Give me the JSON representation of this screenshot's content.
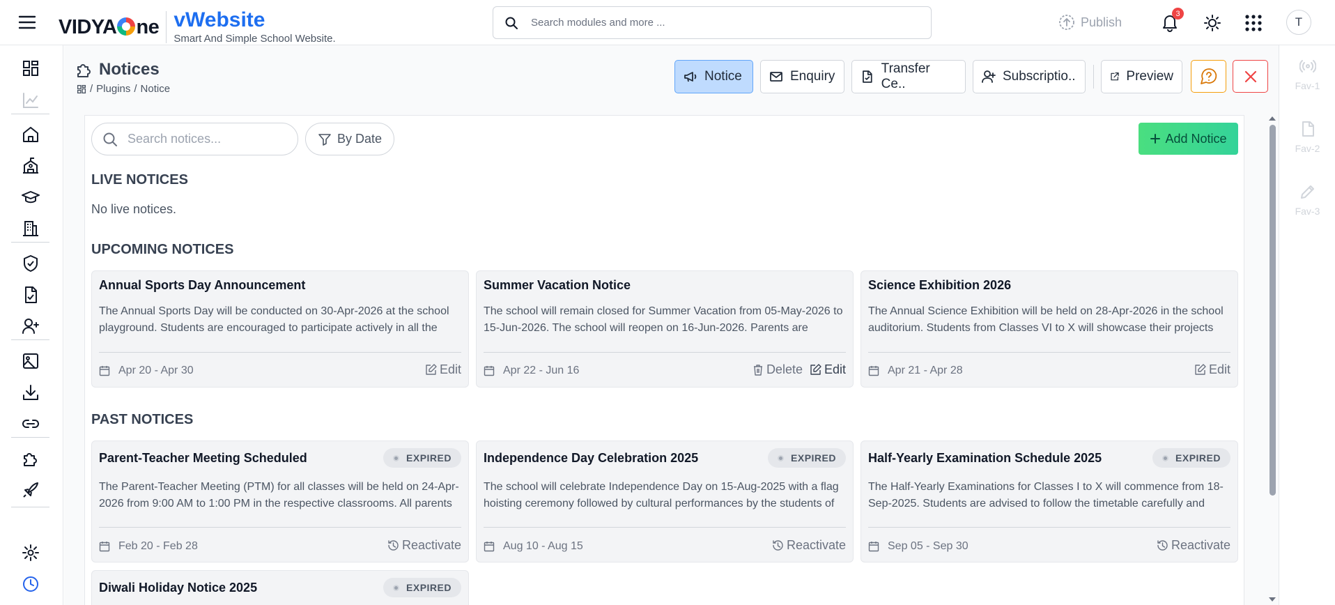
{
  "header": {
    "logo_text": "VIDYAOne",
    "product_name": "vWebsite",
    "tagline": "Smart And Simple School Website.",
    "search_placeholder": "Search modules and more ...",
    "publish_label": "Publish",
    "notification_count": "3",
    "avatar_initial": "T"
  },
  "page": {
    "title": "Notices",
    "breadcrumb": [
      "Plugins",
      "Notice"
    ]
  },
  "toolbar": {
    "tabs": [
      {
        "label": "Notice",
        "icon": "megaphone-icon",
        "active": true
      },
      {
        "label": "Enquiry",
        "icon": "mail-icon",
        "active": false
      },
      {
        "label": "Transfer Ce..",
        "icon": "file-check-icon",
        "active": false
      },
      {
        "label": "Subscriptio..",
        "icon": "user-plus-icon",
        "active": false
      }
    ],
    "preview_label": "Preview"
  },
  "favorites": [
    "Fav-1",
    "Fav-2",
    "Fav-3"
  ],
  "filters": {
    "search_placeholder": "Search notices...",
    "by_date_label": "By Date",
    "add_label": "Add Notice"
  },
  "live": {
    "heading": "LIVE NOTICES",
    "empty_text": "No live notices."
  },
  "upcoming": {
    "heading": "UPCOMING NOTICES",
    "cards": [
      {
        "title": "Annual Sports Day Announcement",
        "description": "The Annual Sports Day will be conducted on 30-Apr-2026 at the school playground. Students are encouraged to participate actively in all the events.",
        "dates": "Apr 20 - Apr 30",
        "delete": "",
        "edit": "Edit"
      },
      {
        "title": "Summer Vacation Notice",
        "description": "The school will remain closed for Summer Vacation from 05-May-2026 to 15-Jun-2026. The school will reopen on 16-Jun-2026. Parents are requested to take note.",
        "dates": "Apr 22 - Jun 16",
        "delete": "Delete",
        "edit": "Edit"
      },
      {
        "title": "Science Exhibition 2026",
        "description": "The Annual Science Exhibition will be held on 28-Apr-2026 in the school auditorium. Students from Classes VI to X will showcase their projects and models.",
        "dates": "Apr 21 - Apr 28",
        "delete": "",
        "edit": "Edit"
      }
    ]
  },
  "past": {
    "heading": "PAST NOTICES",
    "status_label": "EXPIRED",
    "cards": [
      {
        "title": "Parent-Teacher Meeting Scheduled",
        "description": "The Parent-Teacher Meeting (PTM) for all classes will be held on 24-Apr-2026 from 9:00 AM to 1:00 PM in the respective classrooms. All parents are requested to attend.",
        "dates": "Feb 20 - Feb 28",
        "action": "Reactivate"
      },
      {
        "title": "Independence Day Celebration 2025",
        "description": "The school will celebrate Independence Day on 15-Aug-2025 with a flag hoisting ceremony followed by cultural performances by the students of all classes.",
        "dates": "Aug 10 - Aug 15",
        "action": "Reactivate"
      },
      {
        "title": "Half-Yearly Examination Schedule 2025",
        "description": "The Half-Yearly Examinations for Classes I to X will commence from 18-Sep-2025. Students are advised to follow the timetable carefully and prepare well.",
        "dates": "Sep 05 - Sep 30",
        "action": "Reactivate"
      },
      {
        "title": "Diwali Holiday Notice 2025",
        "description": "",
        "dates": "",
        "action": ""
      }
    ]
  },
  "colors": {
    "brand_blue": "#1d6ef0",
    "active_tab": "#bfdbfe",
    "add_button": "#34d399",
    "help_border": "#f59e0b",
    "close_border": "#ef4444",
    "badge_red": "#ef4444"
  }
}
